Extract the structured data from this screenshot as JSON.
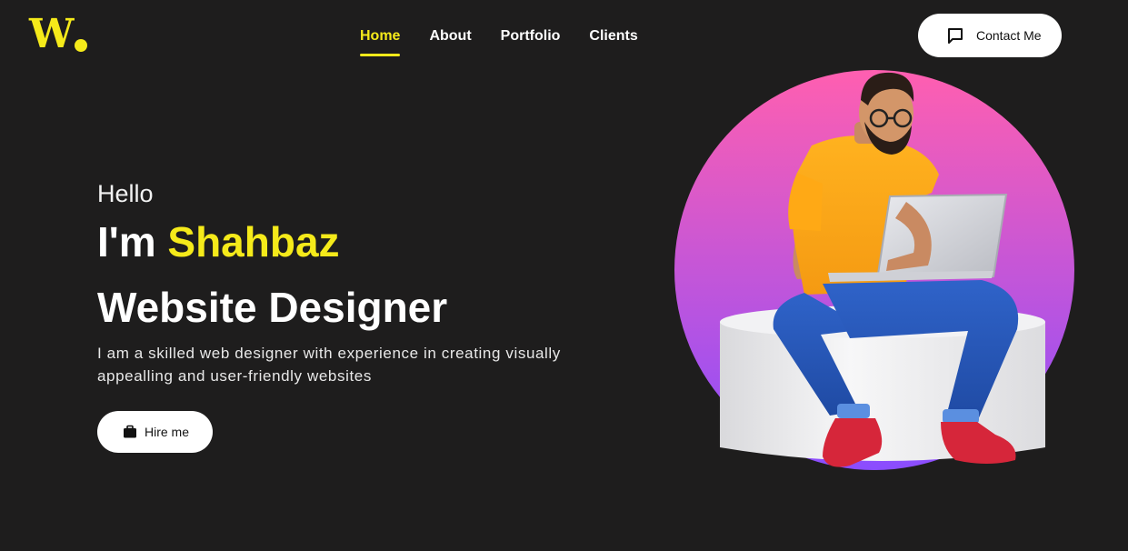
{
  "colors": {
    "background": "#1e1d1d",
    "accent": "#f5ea1a",
    "button_bg": "#ffffff",
    "text": "#ffffff",
    "circle_top": "#ff5fb0",
    "circle_bottom": "#8a4dff"
  },
  "logo": {
    "letter": "W"
  },
  "nav": {
    "items": [
      {
        "label": "Home",
        "active": true
      },
      {
        "label": "About",
        "active": false
      },
      {
        "label": "Portfolio",
        "active": false
      },
      {
        "label": "Clients",
        "active": false
      }
    ]
  },
  "contact_button": {
    "label": "Contact Me",
    "icon": "chat-bubble-icon"
  },
  "hero": {
    "greeting": "Hello",
    "intro_prefix": "I'm ",
    "name": "Shahbaz",
    "role": "Website Designer",
    "description": "I am a skilled web designer with experience in creating visually appealling and user-friendly websites",
    "hire_button": {
      "label": "Hire me",
      "icon": "briefcase-icon"
    }
  },
  "illustration": {
    "subject": "person-with-laptop-illustration"
  }
}
